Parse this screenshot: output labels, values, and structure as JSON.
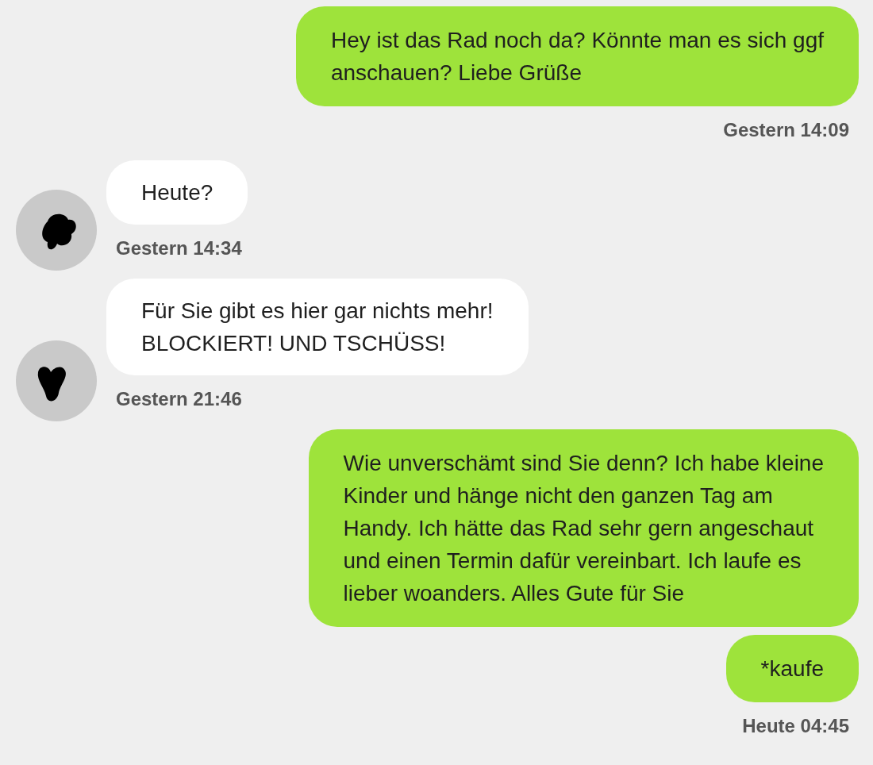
{
  "messages": [
    {
      "kind": "outgoing",
      "lines": [
        "Hey ist das Rad noch da? Könnte man es sich ggf",
        "anschauen? Liebe Grüße"
      ],
      "time": "Gestern 14:09"
    },
    {
      "kind": "incoming",
      "lines": [
        "Heute?"
      ],
      "time": "Gestern 14:34"
    },
    {
      "kind": "incoming",
      "lines": [
        "Für Sie gibt es hier gar nichts mehr!",
        "BLOCKIERT! UND TSCHÜSS!"
      ],
      "time": "Gestern 21:46"
    },
    {
      "kind": "outgoing",
      "lines": [
        "Wie unverschämt sind Sie denn? Ich habe kleine",
        "Kinder und hänge nicht den ganzen Tag am",
        "Handy. Ich hätte das Rad sehr gern angeschaut",
        "und einen Termin dafür vereinbart. Ich laufe es",
        "lieber woanders. Alles Gute für Sie"
      ]
    },
    {
      "kind": "outgoing",
      "lines": [
        "*kaufe"
      ],
      "time": "Heute 04:45"
    }
  ]
}
